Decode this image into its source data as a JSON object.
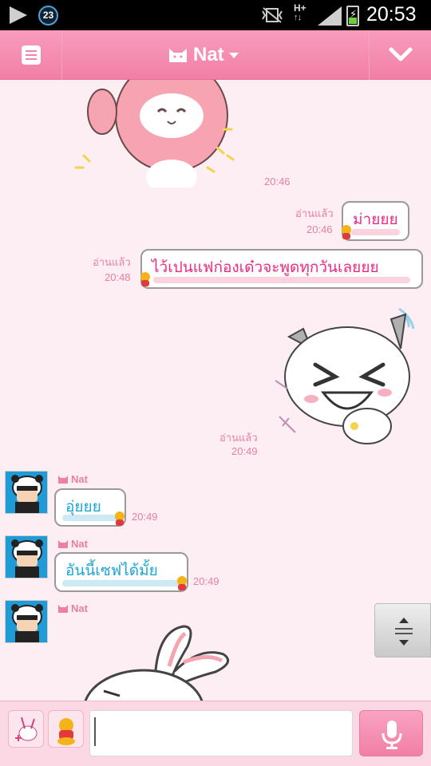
{
  "status_bar": {
    "notification_count": "23",
    "network_type": "H+",
    "time": "20:53"
  },
  "header": {
    "title": "Nat",
    "menu_icon": "menu-icon",
    "collapse_icon": "chevron-down-icon",
    "accent_color": "#f17fa6"
  },
  "messages": {
    "m1_time": "20:46",
    "m2": {
      "read_label": "อ่านแล้ว",
      "time": "20:46",
      "text": "ม่ายยย"
    },
    "m3": {
      "read_label": "อ่านแล้ว",
      "time": "20:48",
      "text": "ไว้เปนแฟก่องเด๋วจะพูดทุกวันเลยยย"
    },
    "m4": {
      "read_label": "อ่านแล้ว",
      "time": "20:49"
    },
    "m5": {
      "sender": "Nat",
      "text": "อุ่ยยย",
      "time": "20:49"
    },
    "m6": {
      "sender": "Nat",
      "text": "อันนี้เซฟได้มั้ย",
      "time": "20:49"
    },
    "m7": {
      "sender": "Nat"
    }
  },
  "input": {
    "value": "",
    "placeholder": ""
  },
  "colors": {
    "my_text": "#ee2a86",
    "their_text": "#1aa7d6",
    "meta_text": "#e77fa3",
    "background": "#fdeef4"
  }
}
